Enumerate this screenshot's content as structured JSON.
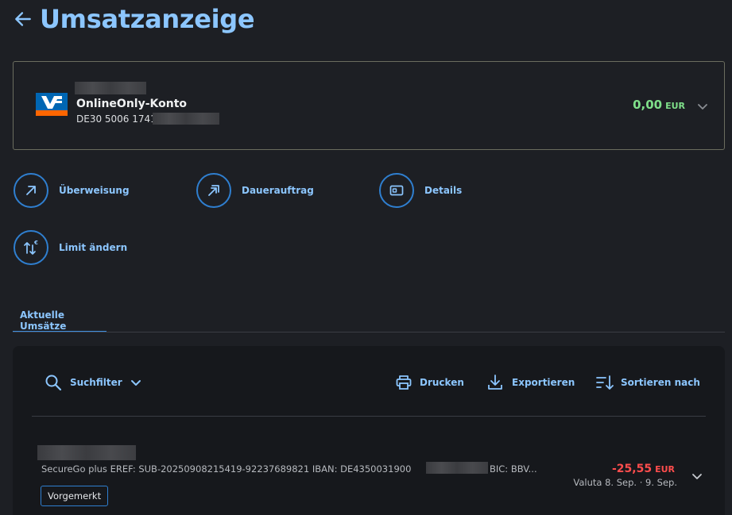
{
  "header": {
    "title": "Umsatzanzeige"
  },
  "account": {
    "name": "OnlineOnly-Konto",
    "iban": "DE30 5006 1741",
    "balance": "0,00",
    "currency": "EUR"
  },
  "actions": [
    {
      "label": "Überweisung",
      "icon": "transfer-arrow-icon"
    },
    {
      "label": "Dauerauftrag",
      "icon": "standing-order-icon"
    },
    {
      "label": "Details",
      "icon": "card-details-icon"
    },
    {
      "label": "Limit ändern",
      "icon": "limit-euro-icon"
    }
  ],
  "tabs": [
    {
      "label": "Aktuelle Umsätze",
      "active": true
    }
  ],
  "toolbar": {
    "search_filter": "Suchfilter",
    "print": "Drucken",
    "export": "Exportieren",
    "sort": "Sortieren nach"
  },
  "transactions": [
    {
      "description": "SecureGo plus EREF: SUB-20250908215419-92237689821 IBAN: DE4350031900",
      "description_tail": "BIC: BBV...",
      "amount": "-25,55",
      "currency": "EUR",
      "valuta": "Valuta  8. Sep.  ·  9. Sep.",
      "status": "Vorgemerkt"
    }
  ],
  "colors": {
    "accent": "#8cc6ff",
    "accent_border": "#2f7fd0",
    "positive": "#7fe08a",
    "negative": "#ff4d4d",
    "background": "#1d1f24"
  }
}
